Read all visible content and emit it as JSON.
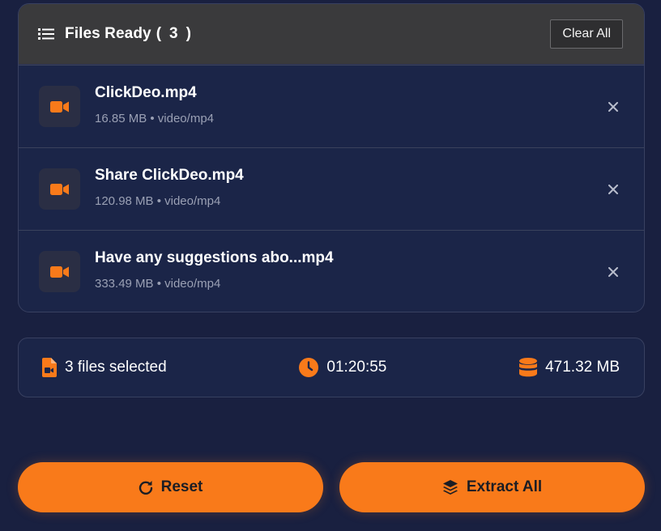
{
  "header": {
    "title": "Files Ready",
    "paren_open": "(",
    "count": "3",
    "paren_close": ")",
    "clear_label": "Clear All"
  },
  "files": [
    {
      "name": "ClickDeo.mp4",
      "meta": "16.85 MB • video/mp4"
    },
    {
      "name": "Share ClickDeo.mp4",
      "meta": "120.98 MB • video/mp4"
    },
    {
      "name": "Have any suggestions abo...mp4",
      "meta": "333.49 MB • video/mp4"
    }
  ],
  "stats": {
    "selected": "3 files selected",
    "duration": "01:20:55",
    "size": "471.32 MB"
  },
  "actions": {
    "reset_label": "Reset",
    "extract_label": "Extract All"
  },
  "colors": {
    "accent": "#f97a1a",
    "background": "#192040",
    "header": "#3a3a3c"
  },
  "icons": {
    "list": "list-icon",
    "file": "video-camera-icon",
    "remove": "close-icon",
    "selected": "file-video-icon",
    "duration": "clock-icon",
    "size": "database-icon",
    "reset": "redo-icon",
    "extract": "layers-icon"
  }
}
